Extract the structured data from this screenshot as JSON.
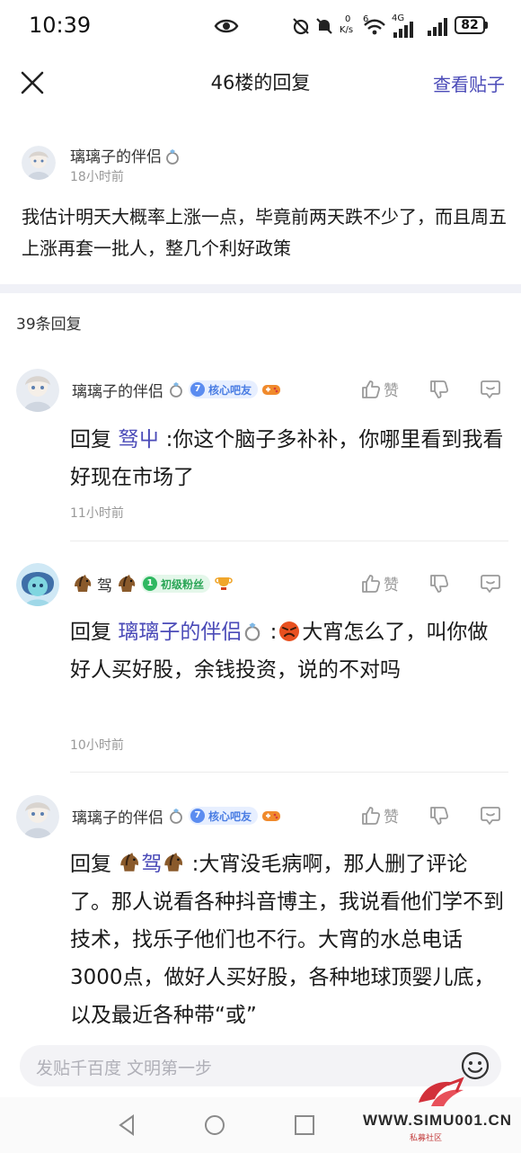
{
  "status_bar": {
    "time": "10:39",
    "net_speed_value": "0",
    "net_speed_unit": "K/s",
    "wifi_label": "6",
    "signal_label": "4G",
    "battery": "82"
  },
  "header": {
    "title": "46楼的回复",
    "view_post": "查看贴子"
  },
  "op": {
    "name": "璃璃子的伴侣",
    "time": "18小时前",
    "body": "我估计明天大概率上涨一点，毕竟前两天跌不少了，而且周五上涨再套一批人，整几个利好政策"
  },
  "replies_count": "39条回复",
  "actions": {
    "like_label": "赞"
  },
  "replies": [
    {
      "name": "璃璃子的伴侣",
      "level": "7",
      "badge": "核心吧友",
      "reply_prefix": "回复",
      "mention": "驽屮",
      "text": ":你这个脑子多补补，你哪里看到我看好现在市场了",
      "time": "11小时前"
    },
    {
      "name": "驾",
      "level": "1",
      "badge": "初级粉丝",
      "reply_prefix": "回复",
      "mention": "璃璃子的伴侣",
      "text": "大宵怎么了，叫你做好人买好股，余钱投资，说的不对吗",
      "time": "10小时前"
    },
    {
      "name": "璃璃子的伴侣",
      "level": "7",
      "badge": "核心吧友",
      "reply_prefix": "回复",
      "mention": "驾",
      "text": ":大宵没毛病啊，那人删了评论了。那人说看各种抖音博主，我说看他们学不到技术，找乐子他们也不行。大宵的水总电话3000点，做好人买好股，各种地球顶婴儿底，以及最近各种带“或”"
    }
  ],
  "input": {
    "placeholder": "发贴千百度 文明第一步"
  },
  "watermark": {
    "url": "WWW.SIMU001.CN",
    "sub": "私募社区"
  },
  "colors": {
    "accent": "#4b4bb8",
    "badge_blue": "#5b8cf0",
    "badge_green": "#2fb861",
    "divider": "#f0f1f7"
  }
}
